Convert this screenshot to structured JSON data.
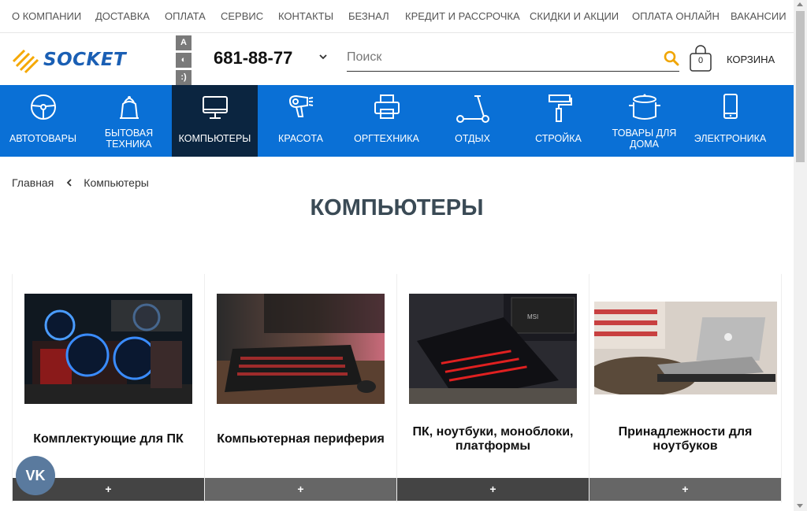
{
  "topnav": [
    "О КОМПАНИИ",
    "ДОСТАВКА",
    "ОПЛАТА",
    "СЕРВИС",
    "КОНТАКТЫ",
    "БЕЗНАЛ",
    "КРЕДИТ И РАССРОЧКА",
    "СКИДКИ И АКЦИИ",
    "ОПЛАТА ОНЛАЙН",
    "ВАКАНСИИ"
  ],
  "header": {
    "logo_text": "SOCKET",
    "a11y": [
      "A",
      "◐",
      ":)"
    ],
    "phone": "681-88-77",
    "search_placeholder": "Поиск",
    "cart_count": "0",
    "cart_label": "КОРЗИНА"
  },
  "categories": [
    {
      "label": "АВТОТОВАРЫ",
      "icon": "steering-wheel-icon"
    },
    {
      "label": "БЫТОВАЯ ТЕХНИКА",
      "icon": "kettle-icon"
    },
    {
      "label": "КОМПЬЮТЕРЫ",
      "icon": "monitor-icon",
      "active": true
    },
    {
      "label": "КРАСОТА",
      "icon": "hair-dryer-icon"
    },
    {
      "label": "ОРГТЕХНИКА",
      "icon": "printer-icon"
    },
    {
      "label": "ОТДЫХ",
      "icon": "scooter-icon"
    },
    {
      "label": "СТРОЙКА",
      "icon": "paint-roller-icon"
    },
    {
      "label": "ТОВАРЫ ДЛЯ ДОМА",
      "icon": "pot-icon"
    },
    {
      "label": "ЭЛЕКТРОНИКА",
      "icon": "smartphone-icon"
    }
  ],
  "breadcrumb": {
    "home": "Главная",
    "current": "Компьютеры"
  },
  "page_title": "КОМПЬЮТЕРЫ",
  "cards": [
    {
      "title": "Комплектующие для ПК",
      "plus": "+"
    },
    {
      "title": "Компьютерная периферия",
      "plus": "+"
    },
    {
      "title": "ПК, ноутбуки, моноблоки, платформы",
      "plus": "+"
    },
    {
      "title": "Принадлежности для ноутбуков",
      "plus": "+"
    }
  ],
  "vk_label": "VK",
  "colors": {
    "catbar": "#0a70d6",
    "active_cat": "#0b2540",
    "search_icon": "#f0a500",
    "logo": "#1a5fb4"
  }
}
